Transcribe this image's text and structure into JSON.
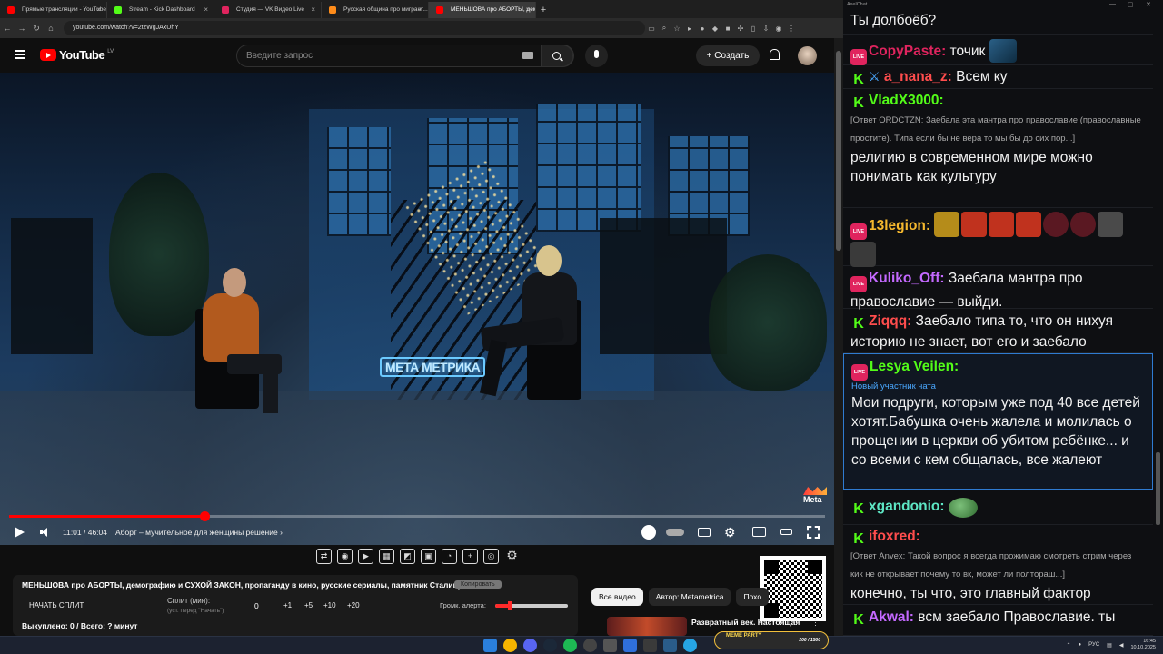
{
  "browser": {
    "tabs": [
      {
        "title": "Прямые трансляции - YouTube",
        "color": "#ff0000"
      },
      {
        "title": "Stream - Kick Dashboard",
        "color": "#53fc18"
      },
      {
        "title": "Студия — VK Видео Live",
        "color": "#e0245e"
      },
      {
        "title": "Русская община про мигрант...",
        "color": "#ff8c1a"
      },
      {
        "title": "МЕНЬШОВА про АБОРТЫ, дем...",
        "color": "#ff0000",
        "active": true
      }
    ],
    "new_tab_label": "+",
    "url": "youtube.com/watch?v=2tzWgJAxUhY",
    "counters": [
      {
        "platform": "youtube-icon",
        "value": "202",
        "color": "#ff0000"
      },
      {
        "platform": "kick-icon",
        "value": "1,661",
        "color": "#53fc18"
      },
      {
        "platform": "vk-live-icon",
        "value": "764",
        "color": "#e0245e"
      },
      {
        "platform": "total-viewers-icon",
        "value": "2,627",
        "color": "#4aa8ff"
      }
    ]
  },
  "youtube": {
    "logo_text": "YouTube",
    "region": "LV",
    "search_placeholder": "Введите запрос",
    "create_label": "Создать",
    "video": {
      "neon_sign_left": "МЕТА",
      "neon_sign_right": "МЕТРИКА",
      "watermark": "Meta",
      "progress_fraction": 0.239,
      "time": "11:01 / 46:04",
      "chapter": "Аборт – мучительное для женщины решение"
    },
    "chips": [
      "Все видео",
      "Автор: Metametrica",
      "Похо"
    ],
    "recommendation_title": "Развратный век. Настоящая"
  },
  "split_panel": {
    "title": "МЕНЬШОВА про АБОРТЫ, демографию и СУХОЙ ЗАКОН, пропаганду в кино, русские сериалы, памятник Сталину",
    "copy_label": "Копировать",
    "start_label": "НАЧАТЬ СПЛИТ",
    "split_label": "Сплит (мин):",
    "split_hint": "(уст. перед \"Начать\")",
    "split_value": "0",
    "step_buttons": [
      "+1",
      "+5",
      "+10",
      "+20"
    ],
    "alert_label": "Громк. алерта:",
    "alert_volume": 0.2,
    "status": "Выкуплено: 0 / Всего: ? минут"
  },
  "chat": {
    "window_title": "AxelChat",
    "top_text": "Ты долбоёб?",
    "messages": [
      {
        "platform": "live",
        "nick": "CopyPaste:",
        "nick_color": "#e0245e",
        "text": "точик"
      },
      {
        "platform": "kick",
        "nick": "a_nana_z:",
        "nick_color": "#ff4d4d",
        "text": "Всем ку"
      },
      {
        "platform": "kick",
        "nick": "VladX3000:",
        "nick_color": "#53fc18",
        "reply": "[Ответ ORDCTZN: Заебала эта мантра про православие (православные простите). Типа если бы не вера то мы бы до сих пор...]",
        "text": "религию в современном мире можно понимать как культуру"
      },
      {
        "platform": "live",
        "nick": "13legion:",
        "nick_color": "#f5b82e",
        "text": ""
      },
      {
        "platform": "live",
        "nick": "Kuliko_Off:",
        "nick_color": "#c469ff",
        "text": "Заебала мантра про православие — выйди."
      },
      {
        "platform": "kick",
        "nick": "Ziqqq:",
        "nick_color": "#ff4d4d",
        "text": "Заебало типа то, что он нихуя историю не знает, вот его и заебало"
      },
      {
        "platform": "live",
        "nick": "Lesya Veilen:",
        "nick_color": "#53fc18",
        "new_member": "Новый участник чата",
        "text": "Мои подруги, которым уже под 40 все детей хотят.Бабушка очень жалела и молилась о прощении в церкви об убитом ребёнке... и со всеми с кем общалась, все жалеют"
      },
      {
        "platform": "kick",
        "nick": "xgandonio:",
        "nick_color": "#5ee6c4",
        "text": ""
      },
      {
        "platform": "kick",
        "nick": "ifoxred:",
        "nick_color": "#ff4d4d",
        "reply": "[Ответ Anvex: Такой вопрос я всегда прожимаю смотреть стрим через кик не открывает почему то вк, может ли полтораш...]",
        "text": "конечно, ты что, это главный фактор"
      },
      {
        "platform": "kick",
        "nick": "Akwal:",
        "nick_color": "#c469ff",
        "text": "всм заебало Православие. ты"
      }
    ]
  },
  "taskbar": {
    "game_badge_left": "MEME PARTY",
    "game_badge_right": "200 / 1500",
    "lang": "РУС",
    "time": "16:45",
    "date": "10.10.2025"
  }
}
